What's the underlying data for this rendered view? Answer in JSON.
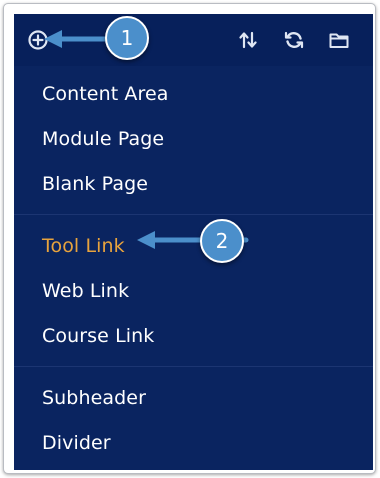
{
  "toolbar": {
    "add_icon": "plus-circle-icon",
    "sort_icon": "up-down-arrows-icon",
    "refresh_icon": "refresh-icon",
    "folder_icon": "folder-icon"
  },
  "menu": {
    "groups": [
      {
        "items": [
          "Content Area",
          "Module Page",
          "Blank Page"
        ]
      },
      {
        "items": [
          "Tool Link",
          "Web Link",
          "Course Link"
        ]
      },
      {
        "items": [
          "Subheader",
          "Divider"
        ]
      }
    ]
  },
  "callouts": {
    "one": "1",
    "two": "2"
  },
  "colors": {
    "panel": "#0a2460",
    "highlight": "#e8a33d",
    "callout": "#4b8fcb"
  }
}
